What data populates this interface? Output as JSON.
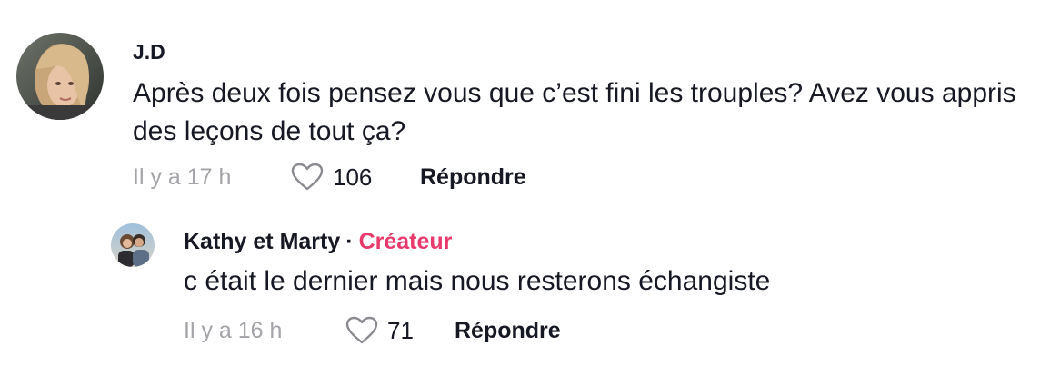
{
  "comment": {
    "username": "J.D",
    "text": "Après deux fois pensez vous que c’est fini les trouples? Avez vous appris des leçons de tout ça?",
    "timestamp": "Il y a 17 h",
    "likes": "106",
    "reply_label": "Répondre"
  },
  "reply": {
    "username": "Kathy et Marty",
    "separator": "·",
    "creator_badge": "Créateur",
    "text": "c était le dernier mais nous resterons échangiste",
    "timestamp": "Il y a 16 h",
    "likes": "71",
    "reply_label": "Répondre"
  },
  "colors": {
    "text": "#161823",
    "secondary": "#a3a3a8",
    "creator": "#e8396b"
  }
}
